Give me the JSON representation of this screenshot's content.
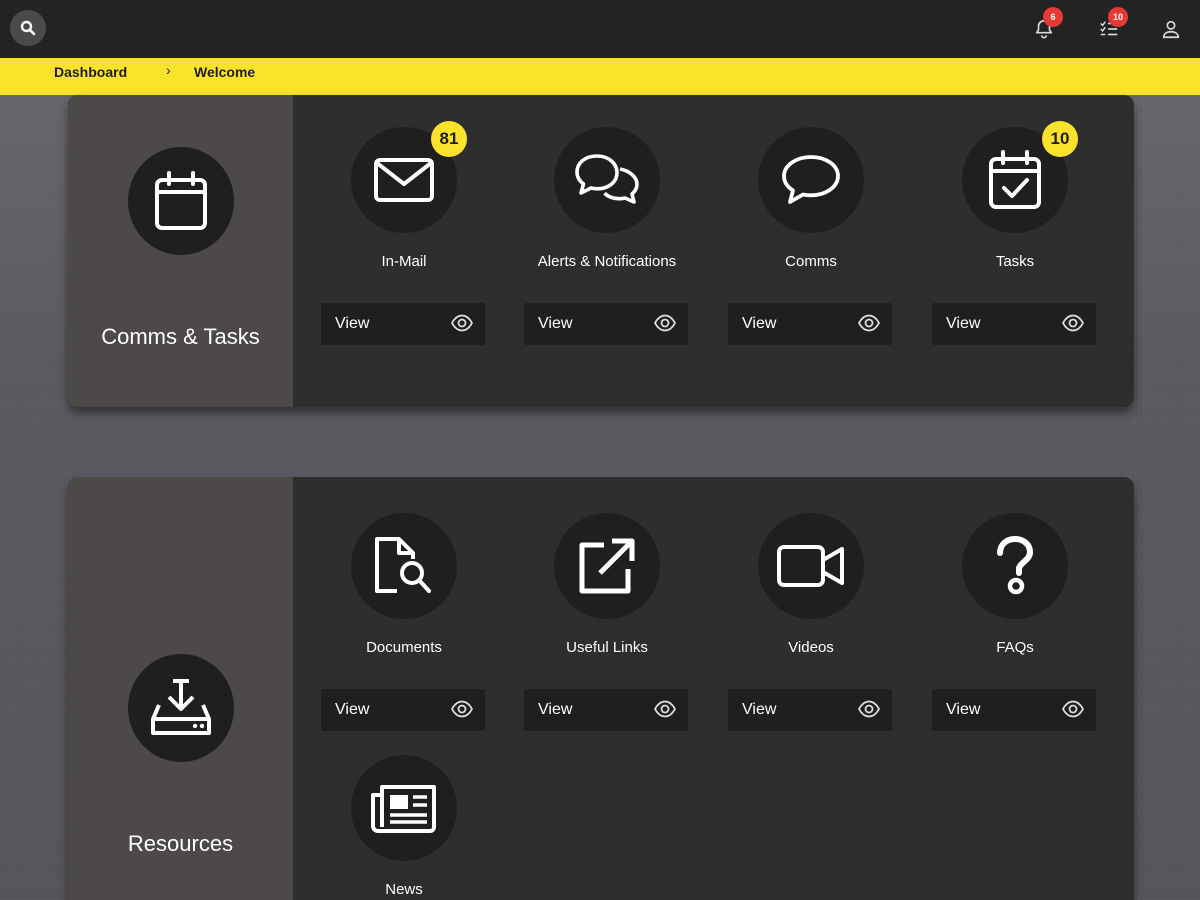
{
  "topbar": {
    "search_icon": "search-icon",
    "notifications": {
      "icon": "bell-icon",
      "count": "6"
    },
    "tasks": {
      "icon": "checklist-icon",
      "count": "10"
    },
    "user_icon": "user-icon"
  },
  "breadcrumb": {
    "items": [
      "Dashboard",
      "Welcome"
    ],
    "separator": "›"
  },
  "sections": [
    {
      "title": "Comms & Tasks",
      "icon": "calendar-icon",
      "tiles": [
        {
          "label": "In-Mail",
          "icon": "envelope-icon",
          "badge": "81",
          "view_label": "View"
        },
        {
          "label": "Alerts & Notifications",
          "icon": "chat-bubbles-icon",
          "view_label": "View"
        },
        {
          "label": "Comms",
          "icon": "speech-bubble-icon",
          "view_label": "View"
        },
        {
          "label": "Tasks",
          "icon": "calendar-check-icon",
          "badge": "10",
          "view_label": "View"
        }
      ]
    },
    {
      "title": "Resources",
      "icon": "download-tray-icon",
      "tiles": [
        {
          "label": "Documents",
          "icon": "document-search-icon",
          "view_label": "View"
        },
        {
          "label": "Useful Links",
          "icon": "external-link-icon",
          "view_label": "View"
        },
        {
          "label": "Videos",
          "icon": "video-camera-icon",
          "view_label": "View"
        },
        {
          "label": "FAQs",
          "icon": "question-icon",
          "view_label": "View"
        },
        {
          "label": "News",
          "icon": "newspaper-icon"
        }
      ]
    }
  ],
  "colors": {
    "accent": "#fce32b",
    "topbar": "#232323",
    "panel": "#2f2e2e",
    "panel_side": "#4c4948",
    "badge_red": "#e53935"
  }
}
